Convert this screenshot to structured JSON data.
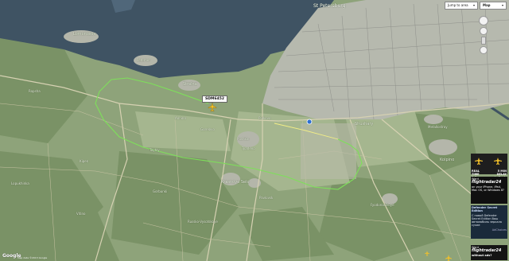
{
  "map": {
    "places": [
      {
        "id": "st-petersburg",
        "name": "St Petersburg",
        "size": "big"
      },
      {
        "id": "lomonosov",
        "name": "Lomonosov",
        "size": "med"
      },
      {
        "id": "peterhof",
        "name": "Peterhof",
        "size": "small"
      },
      {
        "id": "strelna",
        "name": "Strelna",
        "size": "med"
      },
      {
        "id": "pulkovo",
        "name": "Pulkovo",
        "size": "small"
      },
      {
        "id": "shushary",
        "name": "Shushary",
        "size": "med"
      },
      {
        "id": "pushkin",
        "name": "Pushkin",
        "size": "small"
      },
      {
        "id": "tyarlevo",
        "name": "Tyarlevo",
        "size": "small"
      },
      {
        "id": "gatchina-rd",
        "name": "Taytsy",
        "size": "small"
      },
      {
        "id": "krasnoye-selo",
        "name": "Krasnoye Selo",
        "size": "med"
      },
      {
        "id": "kolpino",
        "name": "Kolpino",
        "size": "med"
      },
      {
        "id": "fyodorov",
        "name": "Fyodorovskoye",
        "size": "small"
      },
      {
        "id": "metallostroy",
        "name": "Metallostroy",
        "size": "small"
      },
      {
        "id": "pavlovsk",
        "name": "Pavlovsk",
        "size": "small"
      },
      {
        "id": "ropsha",
        "name": "Ropsha",
        "size": "small"
      },
      {
        "id": "lopukhinka",
        "name": "Lopukhinka",
        "size": "small"
      },
      {
        "id": "vitino",
        "name": "Vitino",
        "size": "small"
      },
      {
        "id": "russko-vysotskoye",
        "name": "Russko-Vysotskoye",
        "size": "small"
      },
      {
        "id": "annino",
        "name": "Annino",
        "size": "small"
      },
      {
        "id": "gorelovo",
        "name": "Gorelovo",
        "size": "small"
      },
      {
        "id": "kipen",
        "name": "Kipen",
        "size": "small"
      },
      {
        "id": "gorbunki",
        "name": "Gorbunki",
        "size": "small"
      }
    ]
  },
  "flight": {
    "callsign": "SDM6452"
  },
  "toolbar": {
    "jump_label": "Jump to area",
    "map_type": "Map"
  },
  "ads": {
    "realtime_line1": "REAL TIME",
    "realtime_line2": "3-5s refresh",
    "delay_line1": "5 MIN DELAY",
    "delay_line2": "in Basic mode",
    "want_line": "Want",
    "brand": "flightradar24",
    "on_your": "on your iPhone, iPad, Mac OS, or Windows 8?",
    "defender_title": "Defender Secret Edition",
    "defender_body": "С новой Defender Secret Edition Ваш автомобиль зеркала сухие",
    "adchoices": "AdChoices",
    "want2": "Want",
    "brand2": "flightradar24",
    "without_ads": "without ads?"
  },
  "footer": {
    "google": "Google",
    "copyright": "Map data ©2013 Google"
  }
}
